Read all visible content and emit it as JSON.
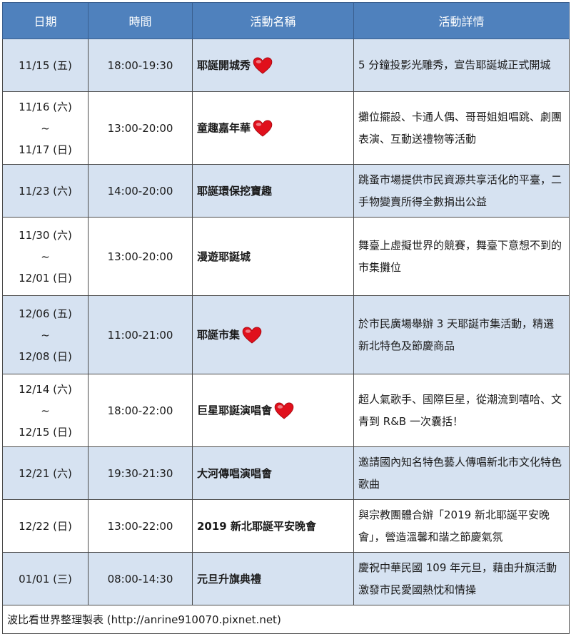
{
  "headers": [
    "日期",
    "時間",
    "活動名稱",
    "活動詳情"
  ],
  "rows": [
    {
      "date": [
        "11/15 (五)"
      ],
      "time": "18:00-19:30",
      "name": "耶誕開城秀",
      "heart": true,
      "detail": "5 分鐘投影光雕秀，宣告耶誕城正式開城"
    },
    {
      "date": [
        "11/16 (六)",
        "~",
        "11/17 (日)"
      ],
      "time": "13:00-20:00",
      "name": "童趣嘉年華",
      "heart": true,
      "detail": "攤位擺設、卡通人偶、哥哥姐姐唱跳、劇團表演、互動送禮物等活動"
    },
    {
      "date": [
        "11/23 (六)"
      ],
      "time": "14:00-20:00",
      "name": "耶誕環保挖寶趣",
      "heart": false,
      "detail": "跳蚤市場提供市民資源共享活化的平臺，二手物變賣所得全數捐出公益"
    },
    {
      "date": [
        "11/30 (六)",
        "~",
        "12/01 (日)"
      ],
      "time": "13:00-20:00",
      "name": "漫遊耶誕城",
      "heart": false,
      "detail": "舞臺上虛擬世界的競賽，舞臺下意想不到的市集攤位"
    },
    {
      "date": [
        "12/06 (五)",
        "~",
        "12/08 (日)"
      ],
      "time": "11:00-21:00",
      "name": "耶誕市集",
      "heart": true,
      "detail": "於市民廣場舉辦 3 天耶誕市集活動，精選新北特色及節慶商品"
    },
    {
      "date": [
        "12/14 (六)",
        "~",
        "12/15 (日)"
      ],
      "time": "18:00-22:00",
      "name": "巨星耶誕演唱會",
      "heart": true,
      "detail": "超人氣歌手、國際巨星，從潮流到嘻哈、文青到 R&B 一次囊括！"
    },
    {
      "date": [
        "12/21 (六)"
      ],
      "time": "19:30-21:30",
      "name": "大河傳唱演唱會",
      "heart": false,
      "detail": "邀請國內知名特色藝人傳唱新北市文化特色歌曲"
    },
    {
      "date": [
        "12/22 (日)"
      ],
      "time": "13:00-22:00",
      "name": "2019 新北耶誕平安晚會",
      "heart": false,
      "detail": "與宗教團體合辦「2019 新北耶誕平安晚會」，營造溫馨和諧之節慶氣氛"
    },
    {
      "date": [
        "01/01 (三)"
      ],
      "time": "08:00-14:30",
      "name": "元旦升旗典禮",
      "heart": false,
      "detail": "慶祝中華民國 109 年元旦，藉由升旗活動激發市民愛國熱忱和情操"
    }
  ],
  "footer": "波比看世界整理製表 (http://anrine910070.pixnet.net)",
  "colors": {
    "header_bg": "#4f81bd",
    "shaded_row": "#d6e2f1",
    "heart": "#e0101c"
  }
}
